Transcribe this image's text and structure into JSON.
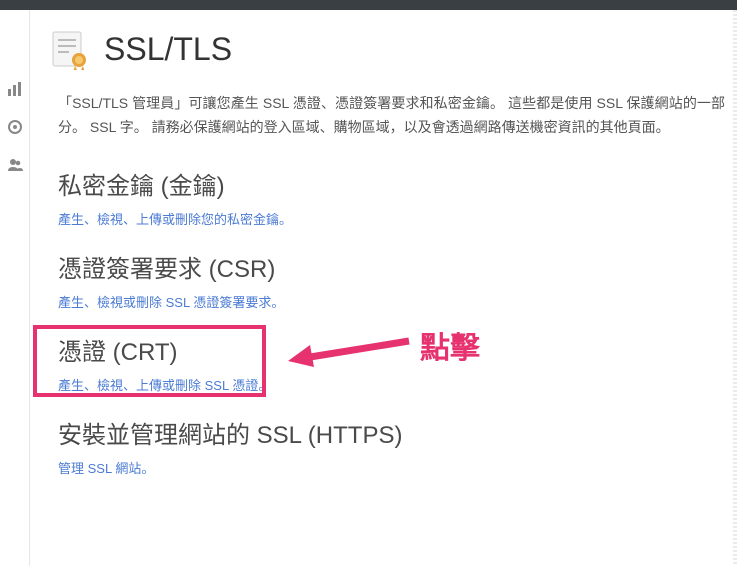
{
  "pageTitle": "SSL/TLS",
  "intro": "「SSL/TLS 管理員」可讓您產生 SSL 憑證、憑證簽署要求和私密金鑰。 這些都是使用 SSL 保護網站的一部分。 SSL 字。 請務必保護網站的登入區域、購物區域，以及會透過網路傳送機密資訊的其他頁面。",
  "sections": [
    {
      "title": "私密金鑰 (金鑰)",
      "link": "產生、檢視、上傳或刪除您的私密金鑰。"
    },
    {
      "title": "憑證簽署要求 (CSR)",
      "link": "產生、檢視或刪除 SSL 憑證簽署要求。"
    },
    {
      "title": "憑證 (CRT)",
      "link": "產生、檢視、上傳或刪除 SSL 憑證。"
    },
    {
      "title": "安裝並管理網站的 SSL (HTTPS)",
      "link": "管理 SSL 網站。"
    }
  ],
  "annotation": "點擊"
}
